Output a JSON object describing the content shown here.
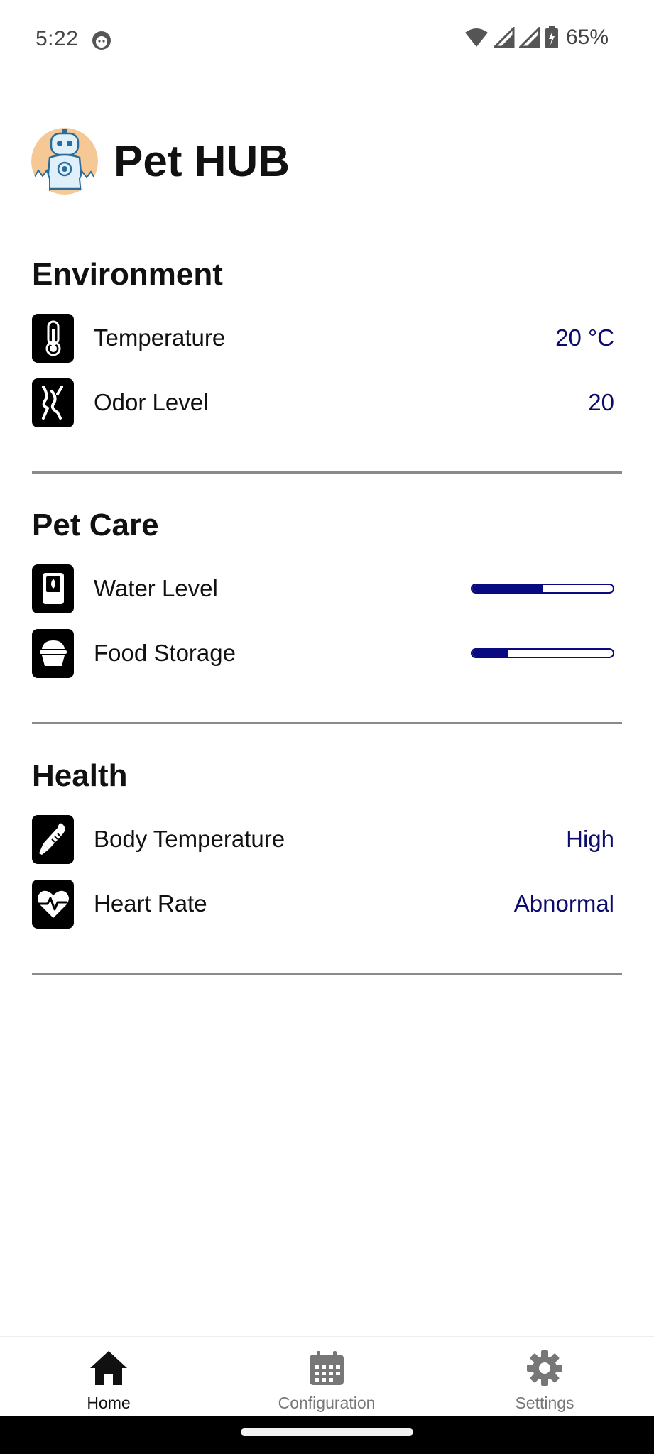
{
  "status_bar": {
    "time": "5:22",
    "battery_percent": "65%"
  },
  "app": {
    "title": "Pet HUB"
  },
  "environment": {
    "title": "Environment",
    "items": [
      {
        "label": "Temperature",
        "value": "20 °C",
        "icon": "thermometer-icon"
      },
      {
        "label": "Odor Level",
        "value": "20",
        "icon": "odor-icon"
      }
    ]
  },
  "pet_care": {
    "title": "Pet Care",
    "items": [
      {
        "label": "Water Level",
        "progress": 0.5,
        "icon": "water-container-icon"
      },
      {
        "label": "Food Storage",
        "progress": 0.25,
        "icon": "food-bowl-icon"
      }
    ]
  },
  "health": {
    "title": "Health",
    "items": [
      {
        "label": "Body Temperature",
        "value": "High",
        "icon": "medical-thermometer-icon"
      },
      {
        "label": "Heart Rate",
        "value": "Abnormal",
        "icon": "heart-rate-icon"
      }
    ]
  },
  "bottom_nav": {
    "items": [
      {
        "label": "Home",
        "icon": "home-icon",
        "active": true
      },
      {
        "label": "Configuration",
        "icon": "calendar-icon",
        "active": false
      },
      {
        "label": "Settings",
        "icon": "gear-icon",
        "active": false
      }
    ]
  },
  "colors": {
    "accent": "#0a0a80",
    "value_text": "#0b0b6e",
    "divider": "#8a8a8a"
  }
}
